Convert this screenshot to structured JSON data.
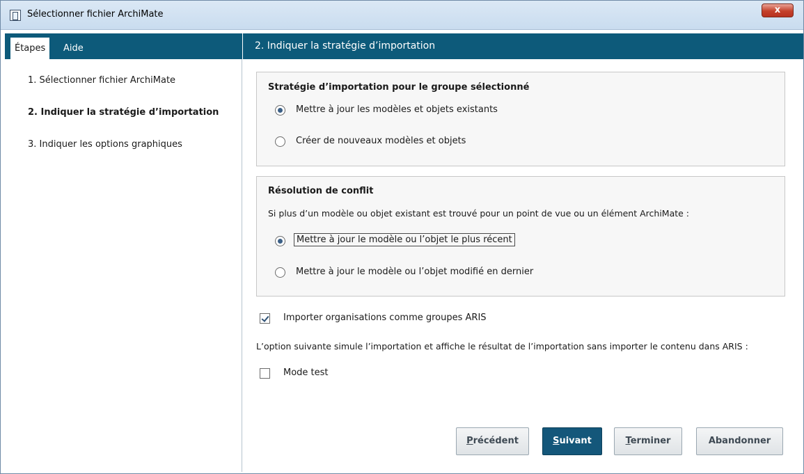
{
  "window": {
    "title": "Sélectionner fichier ArchiMate",
    "close_label": "x"
  },
  "sidebar": {
    "tabs": [
      {
        "label": "Étapes",
        "active": true
      },
      {
        "label": "Aide",
        "active": false
      }
    ],
    "steps": [
      {
        "label": "1. Sélectionner fichier ArchiMate",
        "current": false
      },
      {
        "label": "2. Indiquer la stratégie d’importation",
        "current": true
      },
      {
        "label": "3. Indiquer les options graphiques",
        "current": false
      }
    ]
  },
  "main": {
    "header": "2. Indiquer la stratégie d’importation",
    "import_strategy": {
      "title": "Stratégie d’importation pour le groupe sélectionné",
      "options": [
        {
          "label": "Mettre à jour les modèles et objets existants",
          "selected": true
        },
        {
          "label": "Créer de nouveaux modèles et objets",
          "selected": false
        }
      ]
    },
    "conflict": {
      "title": "Résolution de conflit",
      "description": "Si plus d’un modèle ou objet existant est trouvé pour un point de vue ou un élément ArchiMate :",
      "options": [
        {
          "label": "Mettre à jour le modèle ou l’objet le plus récent",
          "selected": true
        },
        {
          "label": "Mettre à jour le modèle ou l’objet modifié en dernier",
          "selected": false
        }
      ]
    },
    "import_orgs": {
      "label": "Importer organisations comme groupes ARIS",
      "checked": true
    },
    "simulation_note": "L’option suivante simule l’importation et affiche le résultat de l’importation sans importer le contenu dans ARIS :",
    "test_mode": {
      "label": "Mode test",
      "checked": false
    }
  },
  "buttons": {
    "previous": {
      "mnemonic": "P",
      "rest": "récédent"
    },
    "next": {
      "mnemonic": "S",
      "rest": "uivant"
    },
    "finish": {
      "mnemonic": "T",
      "rest": "erminer"
    },
    "abort": "Abandonner"
  },
  "colors": {
    "header_bg": "#0d5a7a",
    "primary_button": "#14577a"
  }
}
